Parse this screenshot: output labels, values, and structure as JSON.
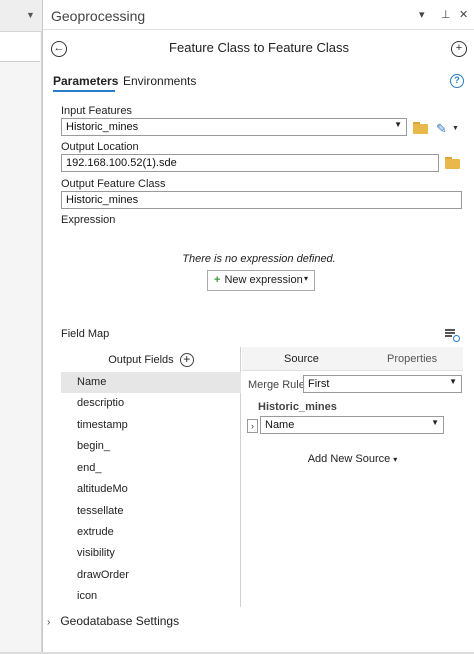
{
  "pane": {
    "title": "Geoprocessing",
    "controls": {
      "dropdown": "▾",
      "pin": "⊥",
      "close": "✕"
    }
  },
  "tool": {
    "title": "Feature Class to Feature Class",
    "back_icon": "back-arrow-icon",
    "add_icon": "plus-circle-icon"
  },
  "tabs": [
    {
      "label": "Parameters",
      "active": true
    },
    {
      "label": "Environments",
      "active": false
    }
  ],
  "params": {
    "input_features": {
      "label": "Input Features",
      "value": "Historic_mines"
    },
    "output_location": {
      "label": "Output Location",
      "value": "192.168.100.52(1).sde"
    },
    "output_feature_class": {
      "label": "Output Feature Class",
      "value": "Historic_mines"
    },
    "expression": {
      "label": "Expression",
      "empty_text": "There is no expression defined.",
      "new_button": "New expression"
    }
  },
  "field_map": {
    "label": "Field Map",
    "output_fields_label": "Output Fields",
    "fields": [
      "Name",
      "descriptio",
      "timestamp",
      "begin_",
      "end_",
      "altitudeMo",
      "tessellate",
      "extrude",
      "visibility",
      "drawOrder",
      "icon"
    ],
    "selected_field": "Name",
    "right_tabs": {
      "source": "Source",
      "properties": "Properties"
    },
    "merge_rule_label": "Merge Rule",
    "merge_rule_value": "First",
    "source_group": "Historic_mines",
    "source_field": "Name",
    "add_new_source": "Add New Source"
  },
  "geodatabase_settings": {
    "label": "Geodatabase Settings"
  },
  "colors": {
    "accent": "#2a7cc7",
    "folder": "#e9b84a",
    "plus_green": "#3c9a3c",
    "selected_row": "#e6e6e6"
  }
}
